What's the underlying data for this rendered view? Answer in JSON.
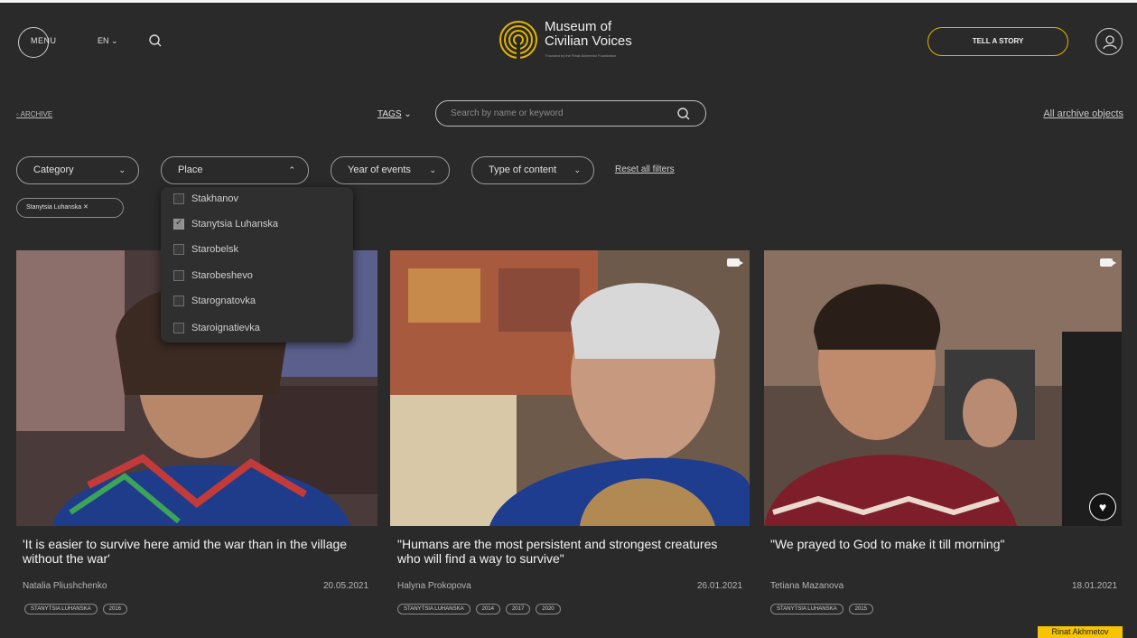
{
  "header": {
    "menu_label": "MENU",
    "language": "EN",
    "logo_title_line1": "Museum of",
    "logo_title_line2": "Civilian Voices",
    "logo_subtitle": "Founded by the Rinat Akhmetov Foundation",
    "tell_story_label": "TELL A STORY"
  },
  "archive_bar": {
    "breadcrumb": "ARCHIVE",
    "tags_label": "TAGS",
    "search_placeholder": "Search by name or keyword",
    "all_objects_link": "All archive objects"
  },
  "filters": {
    "category": "Category",
    "place": "Place",
    "year": "Year of events",
    "type": "Type of content",
    "reset": "Reset all filters",
    "active_chip": "Stanytsia Luhanska ✕"
  },
  "place_dropdown": {
    "options": [
      {
        "label": "Stakhanov",
        "checked": false
      },
      {
        "label": "Stanytsia Luhanska",
        "checked": true
      },
      {
        "label": "Starobelsk",
        "checked": false
      },
      {
        "label": "Starobeshevo",
        "checked": false
      },
      {
        "label": "Starognatovka",
        "checked": false
      },
      {
        "label": "Staroignatievka",
        "checked": false
      }
    ]
  },
  "cards": [
    {
      "title": "'It is easier to survive here amid the war than in the village without the war'",
      "author": "Natalia Pliushchenko",
      "date": "20.05.2021",
      "tags": [
        "STANYTSIA LUHANSKA",
        "2016"
      ],
      "video": false
    },
    {
      "title": "\"Humans are the most persistent and strongest creatures who will find a way to survive\"",
      "author": "Halyna Prokopova",
      "date": "26.01.2021",
      "tags": [
        "STANYTSIA LUHANSKA",
        "2014",
        "2017",
        "2020"
      ],
      "video": true
    },
    {
      "title": "\"We prayed to God to make it till morning\"",
      "author": "Tetiana Mazanova",
      "date": "18.01.2021",
      "tags": [
        "STANYTSIA LUHANSKA",
        "2015"
      ],
      "video": true
    }
  ],
  "signature": "Rinat Akhmetov",
  "colors": {
    "background": "#2a2a2a",
    "accent": "#e2b400",
    "text": "#e6e6e6"
  }
}
